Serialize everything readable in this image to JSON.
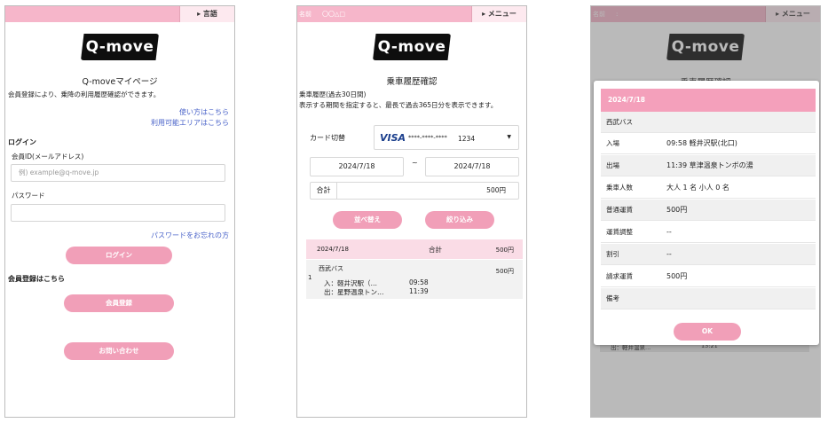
{
  "screen1": {
    "menu_label": "▸ 言語",
    "logo": "Q-move",
    "title": "Q-moveマイページ",
    "intro": "会員登録により、乗降の利用履歴確認ができます。",
    "link_howto": "使い方はこちら",
    "link_area": "利用可能エリアはこちら",
    "login_heading": "ログイン",
    "id_label": "会員ID(メールアドレス)",
    "id_placeholder": "例) example@q-move.jp",
    "password_label": "パスワード",
    "forgot_link": "パスワードをお忘れの方",
    "login_button": "ログイン",
    "register_heading": "会員登録はこちら",
    "register_button": "会員登録",
    "contact_button": "お問い合わせ"
  },
  "screen2": {
    "name_label": "名前",
    "name_value": "〇〇△□",
    "menu_label": "▸ メニュー",
    "logo": "Q-move",
    "title": "乗車履歴確認",
    "desc1": "乗車履歴(過去30日間)",
    "desc2": "表示する期間を指定すると、最長で過去365日分を表示できます。",
    "card_label": "カード切替",
    "card_brand": "VISA",
    "card_mask": "****-****-****",
    "card_last4": "1234",
    "date_from": "2024/7/18",
    "date_sep": "~",
    "date_to": "2024/7/18",
    "total_label": "合計",
    "total_value": "500円",
    "sort_button": "並べ替え",
    "filter_button": "絞り込み",
    "list_header_date": "2024/7/18",
    "list_header_total_label": "合計",
    "list_header_total": "500円",
    "item_company": "西武バス",
    "item_amount": "500円",
    "item_index": "1",
    "item_in": "入：軽井沢駅（…",
    "item_in_time": "09:58",
    "item_out": "出：星野温泉トン…",
    "item_out_time": "11:39"
  },
  "screen3": {
    "name_label": "名前",
    "name_value": ":",
    "menu_label": "▸ メニュー",
    "logo": "Q-move",
    "bg_title": "乗車履歴確認",
    "bg_item": "出：軽井温泉...",
    "bg_time": "13:21",
    "modal": {
      "date": "2024/7/18",
      "company": "西武バス",
      "rows": [
        {
          "label": "入場",
          "value": "09:58  軽井沢駅(北口)"
        },
        {
          "label": "出場",
          "value": "11:39  草津温泉トンボの湯"
        },
        {
          "label": "乗車人数",
          "value": "大人  1  名    小人  0  名"
        },
        {
          "label": "普通運賃",
          "value": "500円"
        },
        {
          "label": "運賃調整",
          "value": "--"
        },
        {
          "label": "割引",
          "value": "--"
        },
        {
          "label": "請求運賃",
          "value": "500円"
        },
        {
          "label": "備考",
          "value": ""
        }
      ],
      "ok_button": "OK"
    }
  },
  "colors": {
    "header_pink": "#f6b6ca",
    "button_pink": "#f19fb8",
    "modal_header": "#f4a0bb",
    "link_blue": "#4a63c9",
    "visa_blue": "#1a3e8c"
  }
}
